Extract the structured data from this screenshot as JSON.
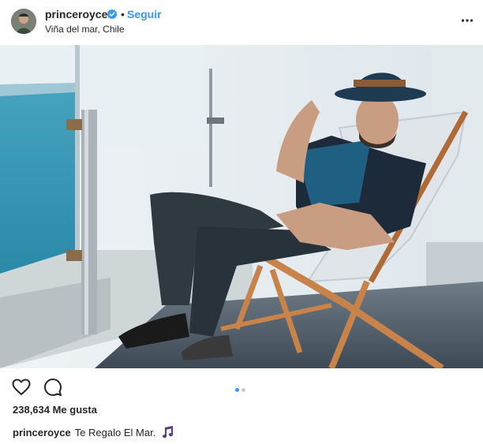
{
  "post": {
    "username": "princeroyce",
    "separator": "•",
    "follow_label": "Seguir",
    "location": "Viña del mar, Chile"
  },
  "actions": {
    "carousel": {
      "count": 2,
      "active_index": 0
    }
  },
  "stats": {
    "likes_text": "238,634 Me gusta"
  },
  "caption": {
    "username": "princeroyce",
    "text": "Te Regalo El Mar."
  },
  "icons": {
    "verified": "verified-badge-icon",
    "more": "more-options-icon",
    "like": "heart-icon",
    "comment": "comment-icon",
    "music": "music-note-emoji"
  },
  "colors": {
    "accent": "#3897f0",
    "text": "#262626",
    "dot_inactive": "#c7c7c7"
  }
}
